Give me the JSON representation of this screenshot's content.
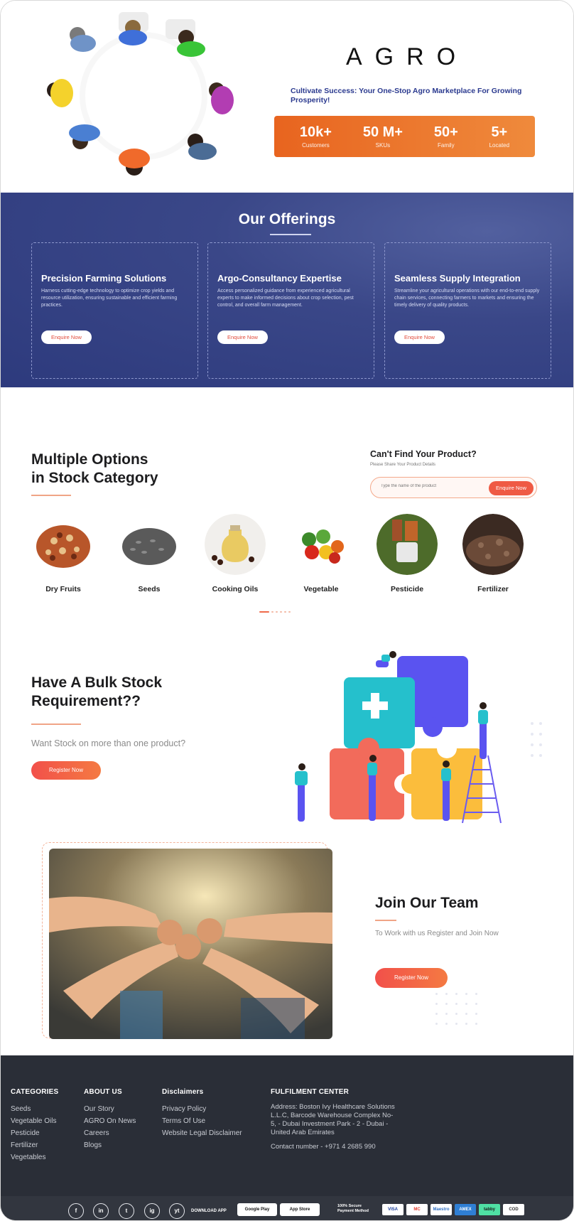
{
  "hero": {
    "brand": "AGRO",
    "tagline": "Cultivate Success: Your One-Stop Agro Marketplace For Growing Prosperity!",
    "stats": [
      {
        "value": "10k+",
        "label": "Customers"
      },
      {
        "value": "50 M+",
        "label": "SKUs"
      },
      {
        "value": "50+",
        "label": "Family"
      },
      {
        "value": "5+",
        "label": "Located"
      }
    ]
  },
  "offerings": {
    "title": "Our Offerings",
    "cards": [
      {
        "title": "Precision Farming Solutions",
        "text": "Harness cutting-edge technology to optimize crop yields and resource utilization, ensuring sustainable and efficient farming practices.",
        "button": "Enquire Now"
      },
      {
        "title": "Argo-Consultancy Expertise",
        "text": "Access personalized guidance from experienced agricultural experts to make informed decisions about crop selection, pest control, and overall farm management.",
        "button": "Enquire Now"
      },
      {
        "title": "Seamless Supply Integration",
        "text": "Streamline your agricultural operations with our end-to-end supply chain services, connecting farmers to markets and ensuring the timely delivery of quality products.",
        "button": "Enquire Now"
      }
    ]
  },
  "categories": {
    "title_line1": "Multiple Options",
    "title_line2": "in Stock Category",
    "items": [
      "Dry Fruits",
      "Seeds",
      "Cooking Oils",
      "Vegetable",
      "Pesticide",
      "Fertilizer"
    ]
  },
  "find_product": {
    "title": "Can't Find Your Product?",
    "subtitle": "Please Share Your Product Details",
    "placeholder": "Type the name of the product",
    "button": "Enquire Now"
  },
  "bulk": {
    "title_line1": "Have A Bulk Stock",
    "title_line2": "Requirement??",
    "subtitle": "Want Stock on more than one product?",
    "button": "Register Now"
  },
  "team": {
    "title": "Join Our Team",
    "subtitle": "To Work with us Register and Join Now",
    "button": "Register Now"
  },
  "footer": {
    "categories": {
      "heading": "CATEGORIES",
      "links": [
        "Seeds",
        "Vegetable Oils",
        "Pesticide",
        "Fertilizer",
        "Vegetables"
      ]
    },
    "about": {
      "heading": "ABOUT US",
      "links": [
        "Our Story",
        "AGRO On News",
        "Careers",
        "Blogs"
      ]
    },
    "disclaimers": {
      "heading": "Disclaimers",
      "links": [
        "Privacy Policy",
        "Terms Of Use",
        "Website Legal Disclaimer"
      ]
    },
    "fulfilment": {
      "heading": "FULFILMENT CENTER",
      "address": "Address: Boston Ivy Healthcare Solutions L.L.C, Barcode Warehouse Complex No-5, - Dubai Investment Park - 2 - Dubai - United Arab Emirates",
      "contact": "Contact number - +971 4 2685 990"
    },
    "bottom": {
      "social": [
        "f",
        "in",
        "t",
        "ig",
        "yt"
      ],
      "download_label": "DOWNLOAD APP",
      "google_play": "Google Play",
      "app_store": "App Store",
      "secure_line1": "100% Secure",
      "secure_line2": "Payment Method",
      "payments": [
        {
          "name": "VISA",
          "bg": "#ffffff",
          "fg": "#1a3d9b"
        },
        {
          "name": "MC",
          "bg": "#ffffff",
          "fg": "#e33a2d"
        },
        {
          "name": "Maestro",
          "bg": "#ffffff",
          "fg": "#2f6fc3"
        },
        {
          "name": "AMEX",
          "bg": "#2f7fd4",
          "fg": "#ffffff"
        },
        {
          "name": "tabby",
          "bg": "#4fe0a4",
          "fg": "#1a1a1a"
        },
        {
          "name": "COD",
          "bg": "#ffffff",
          "fg": "#333333"
        }
      ]
    }
  },
  "colors": {
    "accent": "#ef5a44",
    "navy": "#2d3a7d",
    "footer": "#2a2e37"
  }
}
